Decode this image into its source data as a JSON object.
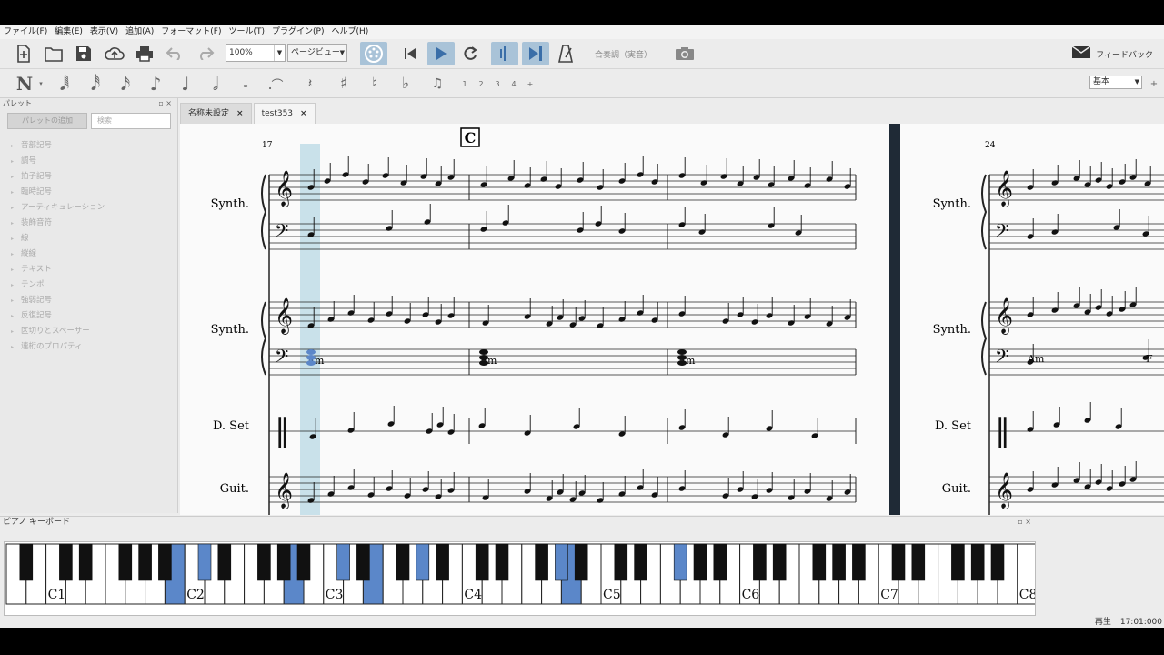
{
  "menu": [
    "ファイル(F)",
    "編集(E)",
    "表示(V)",
    "追加(A)",
    "フォーマット(F)",
    "ツール(T)",
    "プラグイン(P)",
    "ヘルプ(H)"
  ],
  "toolbar": {
    "zoom_value": "100%",
    "view_mode": "ページビュー",
    "concert_pitch": "合奏調（実音）",
    "feedback": "フィードバック"
  },
  "note_toolbar": {
    "voices": [
      "1",
      "2",
      "3",
      "4"
    ],
    "workspace": "基本",
    "add": "+"
  },
  "palette": {
    "title": "パレット",
    "add_button": "パレットの追加",
    "search_placeholder": "検索",
    "items": [
      "音部記号",
      "調号",
      "拍子記号",
      "臨時記号",
      "アーティキュレーション",
      "装飾音符",
      "線",
      "縦線",
      "テキスト",
      "テンポ",
      "強弱記号",
      "反復記号",
      "区切りとスペーサー",
      "連桁のプロパティ"
    ]
  },
  "tabs": [
    {
      "label": "名称未設定",
      "close": "×"
    },
    {
      "label": "test353",
      "close": "×"
    }
  ],
  "score": {
    "rehearsal_mark": "C",
    "measure_left": "17",
    "measure_right": "24",
    "instruments": [
      "Synth.",
      "Synth.",
      "D. Set",
      "Guit."
    ],
    "chords_left": [
      "Am",
      "Em",
      "Am"
    ],
    "chords_right": [
      "Am",
      "F"
    ]
  },
  "piano": {
    "title": "ピアノ キーボード",
    "labels": [
      "C1",
      "C2",
      "C3",
      "C4",
      "C5",
      "C6",
      "C7",
      "C8"
    ],
    "highlighted_white": [
      8,
      14,
      18,
      28
    ],
    "highlighted_black": [
      6,
      11,
      14,
      19,
      23
    ]
  },
  "status": {
    "state": "再生",
    "time": "17:01:000"
  },
  "colors": {
    "accent": "#5b87c9",
    "playhead": "#a8d0e0",
    "divider": "#1f2a36"
  }
}
